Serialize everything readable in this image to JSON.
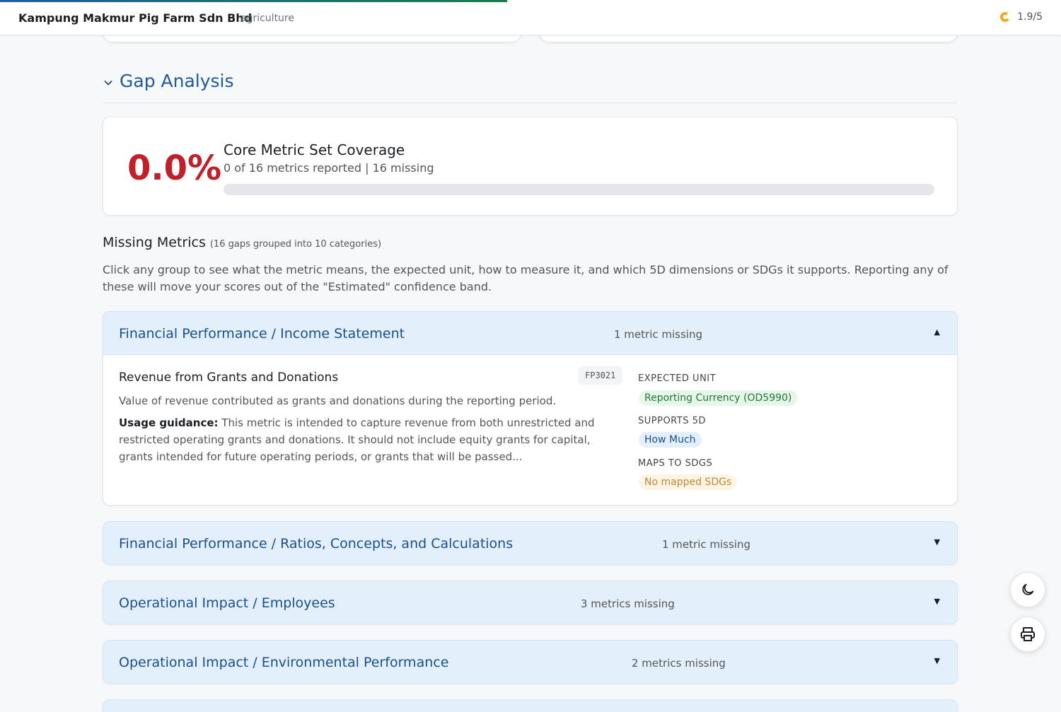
{
  "header": {
    "company_name": "Kampung Makmur Pig Farm Sdn Bhd",
    "sector": "agriculture",
    "score": "1.9/5",
    "score_color": "#f5a623"
  },
  "gap_analysis": {
    "section_title": "Gap Analysis",
    "coverage": {
      "percent_label": "0.0%",
      "title": "Core Metric Set Coverage",
      "subtitle": "0 of 16 metrics reported | 16 missing",
      "fraction": 0.0
    },
    "missing": {
      "title": "Missing Metrics",
      "count_label": "(16 gaps grouped into 10 categories)",
      "description": "Click any group to see what the metric means, the expected unit, how to measure it, and which 5D dimensions or SDGs it supports. Reporting any of these will move your scores out of the \"Estimated\" confidence band."
    },
    "groups": [
      {
        "title": "Financial Performance / Income Statement",
        "count": "1 metric missing",
        "toggle": "▲",
        "metric": {
          "name": "Revenue from Grants and Donations",
          "code": "FP3021",
          "description": "Value of revenue contributed as grants and donations during the reporting period.",
          "guidance_label": "Usage guidance:",
          "guidance_text": " This metric is intended to capture revenue from both unrestricted and restricted operating grants and donations. It should not include equity grants for capital, grants intended for future operating periods, or grants that will be passed...",
          "expected_unit_label": "EXPECTED UNIT",
          "expected_unit": "Reporting Currency (OD5990)",
          "supports_label": "SUPPORTS 5D",
          "supports": "How Much",
          "sdg_label": "MAPS TO SDGS",
          "sdg": "No mapped SDGs"
        }
      },
      {
        "title": "Financial Performance / Ratios, Concepts, and Calculations",
        "count": "1 metric missing",
        "toggle": "▼"
      },
      {
        "title": "Operational Impact / Employees",
        "count": "3 metrics missing",
        "toggle": "▼"
      },
      {
        "title": "Operational Impact / Environmental Performance",
        "count": "2 metrics missing",
        "toggle": "▼"
      }
    ]
  },
  "fabs": {
    "theme_icon": "moon-icon",
    "print_icon": "printer-icon"
  },
  "colors": {
    "accent": "#1f5a96",
    "danger": "#c0202a",
    "group_header_bg": "#e3f0fb"
  },
  "page_progress": 0.478
}
